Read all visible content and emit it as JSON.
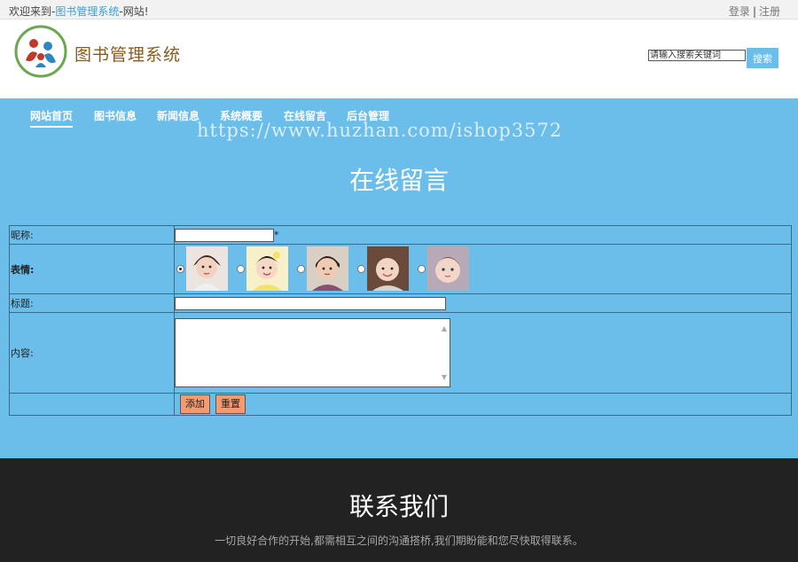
{
  "topbar": {
    "welcome_prefix": "欢迎来到-",
    "site_name": "图书管理系统",
    "welcome_suffix": "-网站!",
    "login": "登录",
    "separator": "|",
    "register": "注册"
  },
  "header": {
    "brand": "图书管理系统",
    "search_placeholder": "请输入搜索关键词",
    "search_button": "搜索"
  },
  "nav": {
    "items": [
      {
        "label": "网站首页",
        "active": true
      },
      {
        "label": "图书信息",
        "active": false
      },
      {
        "label": "新闻信息",
        "active": false
      },
      {
        "label": "系统概要",
        "active": false
      },
      {
        "label": "在线留言",
        "active": false
      },
      {
        "label": "后台管理",
        "active": false
      }
    ]
  },
  "watermark": "https://www.huzhan.com/ishop3572",
  "page_title": "在线留言",
  "form": {
    "nickname_label": "昵称:",
    "required_mark": "*",
    "emotion_label": "表情:",
    "title_label": "标题:",
    "content_label": "内容:",
    "add_button": "添加",
    "reset_button": "重置",
    "faces": [
      {
        "icon": "face-1-icon",
        "selected": true
      },
      {
        "icon": "face-2-icon",
        "selected": false
      },
      {
        "icon": "face-3-icon",
        "selected": false
      },
      {
        "icon": "face-4-icon",
        "selected": false
      },
      {
        "icon": "face-5-icon",
        "selected": false
      }
    ]
  },
  "footer": {
    "title": "联系我们",
    "text": "一切良好合作的开始,都需相互之间的沟通搭桥,我们期盼能和您尽快取得联系。"
  },
  "colors": {
    "main_bg": "#6bbdea",
    "footer_bg": "#222222",
    "button_bg": "#f39a6e",
    "brand": "#8b5a1a",
    "link": "#3a9fd8"
  }
}
